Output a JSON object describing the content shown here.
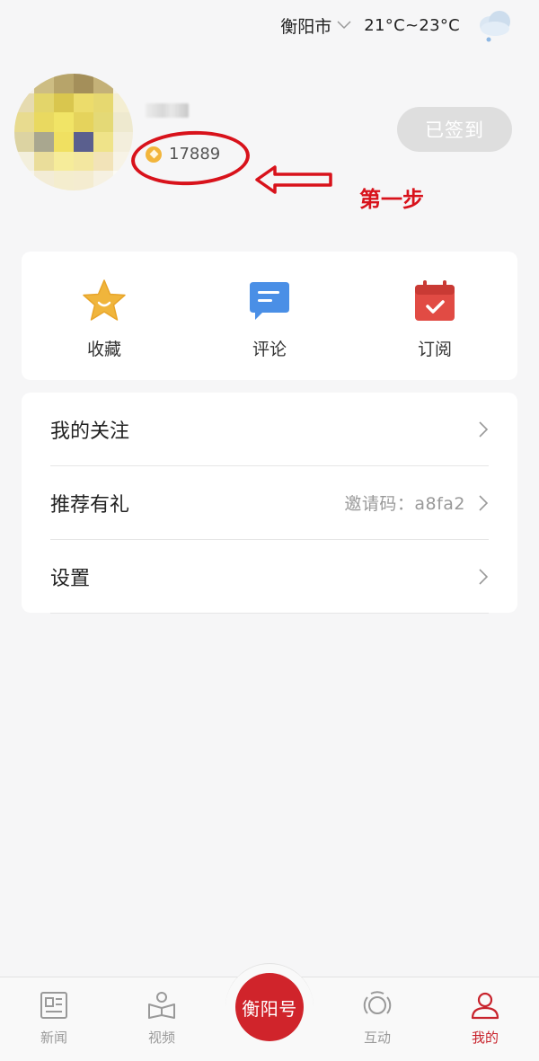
{
  "header": {
    "city": "衡阳市",
    "temperature": "21°C~23°C",
    "weather_icon": "cloud-rain-icon"
  },
  "profile": {
    "points": "17889",
    "checkin_label": "已签到"
  },
  "annotation": {
    "step_text": "第一步",
    "color": "#d8121b"
  },
  "quick_actions": [
    {
      "label": "收藏",
      "icon": "star-icon"
    },
    {
      "label": "评论",
      "icon": "comment-icon"
    },
    {
      "label": "订阅",
      "icon": "subscribe-calendar-icon"
    }
  ],
  "menu": {
    "follow": {
      "label": "我的关注"
    },
    "referral": {
      "label": "推荐有礼",
      "invite": "邀请码：a8fa2"
    },
    "settings": {
      "label": "设置"
    }
  },
  "tabs": [
    {
      "label": "新闻",
      "icon": "news-icon"
    },
    {
      "label": "视频",
      "icon": "video-reader-icon"
    },
    {
      "label": "衡阳号",
      "icon": "center-brand-button"
    },
    {
      "label": "互动",
      "icon": "interaction-icon"
    },
    {
      "label": "我的",
      "icon": "user-icon",
      "active": true
    }
  ],
  "colors": {
    "accent": "#c8232c",
    "background": "#f6f6f7"
  }
}
